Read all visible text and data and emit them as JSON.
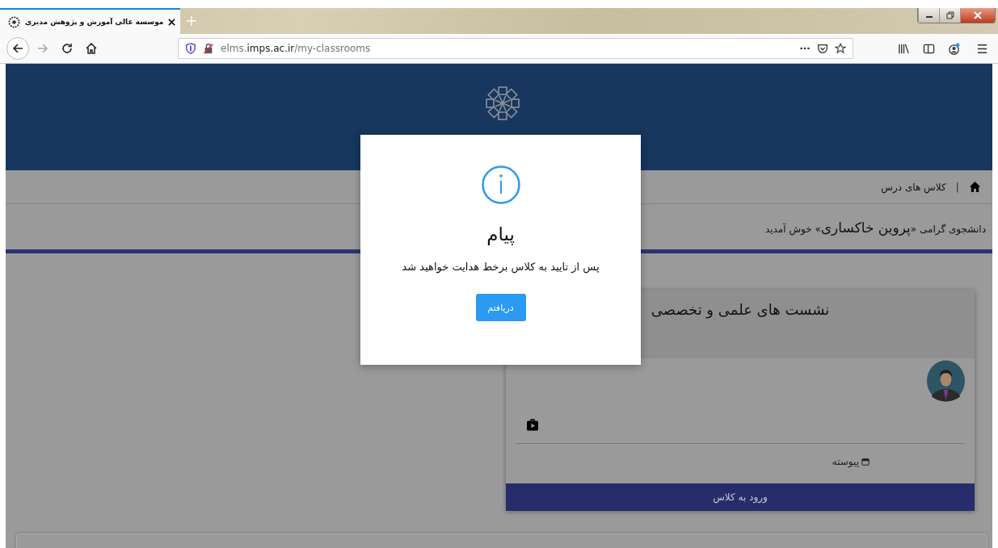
{
  "browser": {
    "tab": {
      "title": "موسسه عالی آموزش و پژوهش مدیری",
      "selected": true
    },
    "nav": [
      {
        "kind": "back",
        "disabled": false
      },
      {
        "kind": "forward",
        "disabled": true
      },
      {
        "kind": "reload",
        "disabled": false
      },
      {
        "kind": "home",
        "disabled": false
      }
    ],
    "address": {
      "prefix": "elms.",
      "domain": "imps.ac.ir",
      "path": "/my-classrooms"
    }
  },
  "breadcrumb": {
    "separator": "|",
    "current": "کلاس های درس"
  },
  "welcome": {
    "before": "دانشجوی گرامی «",
    "name": "پروین خاکساری",
    "after": "» خوش آمدید"
  },
  "card": {
    "title": "نشست های علمی و تخصصی",
    "schedule": "پیوسته",
    "button": "ورود به کلاس"
  },
  "dialog": {
    "title": "پیام",
    "message": "پس از تایید به کلاس برخط هدایت خواهید شد",
    "button": "دریافتم"
  }
}
